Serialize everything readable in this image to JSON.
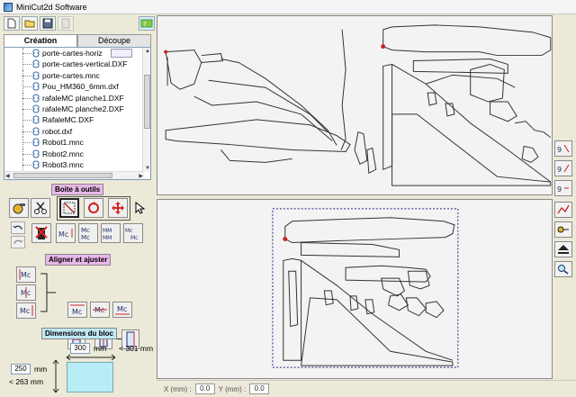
{
  "window": {
    "title": "MiniCut2d Software"
  },
  "toolbar": {
    "icons": [
      "new-file-icon",
      "open-folder-icon",
      "save-icon",
      "disabled-icon",
      "help-icon"
    ]
  },
  "tabs": [
    {
      "label": "Création",
      "active": true
    },
    {
      "label": "Découpe",
      "active": false
    }
  ],
  "files": [
    "porte-cartes-horiz",
    "porte-cartes-vertical.DXF",
    "porte-cartes.mnc",
    "Pou_HM360_6mm.dxf",
    "rafaleMC planche1.DXF",
    "rafaleMC planche2.DXF",
    "RafaleMC.DXF",
    "robot.dxf",
    "Robot1.mnc",
    "Robot2.mnc",
    "Robot3.mnc"
  ],
  "sections": {
    "tools": "Boite à outils",
    "align": "Aligner et ajuster",
    "dims": "Dimensions du bloc"
  },
  "dimensions": {
    "width_value": "300",
    "width_unit": "mm",
    "width_max": "< 301 mm",
    "height_value": "250",
    "height_unit": "mm",
    "height_max": "< 263 mm"
  },
  "status": {
    "x_label": "X (mm) :",
    "x_value": "0.0",
    "y_label": "Y (mm) :",
    "y_value": "0.0"
  },
  "colors": {
    "tools_label_bg": "#e9b7ea",
    "dims_label_bg": "#bfe8f2",
    "block_fill": "#b9ecf7",
    "selection_color": "#222288",
    "start_point": "#cc2222"
  }
}
